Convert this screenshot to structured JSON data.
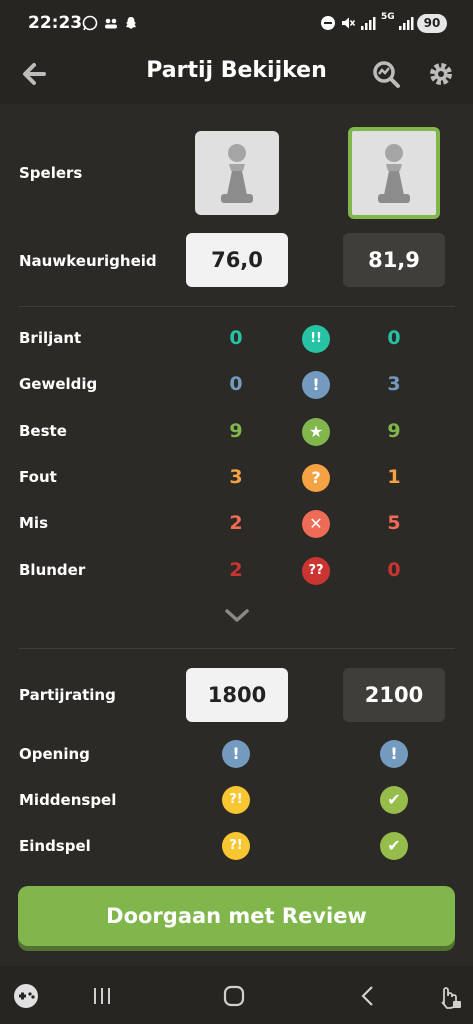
{
  "status": {
    "time": "22:23",
    "battery": "90",
    "network": "5G"
  },
  "header": {
    "title": "Partij Bekijken"
  },
  "rows": {
    "players": "Spelers",
    "accuracy": {
      "label": "Nauwkeurigheid",
      "white": "76,0",
      "black": "81,9"
    }
  },
  "moves": [
    {
      "label": "Briljant",
      "white": "0",
      "black": "0",
      "color": "#26c2a3",
      "icon": "double-exclamation-icon",
      "glyph": "!!"
    },
    {
      "label": "Geweldig",
      "white": "0",
      "black": "3",
      "color": "#749bbf",
      "icon": "exclamation-icon",
      "glyph": "!"
    },
    {
      "label": "Beste",
      "white": "9",
      "black": "9",
      "color": "#81b64c",
      "icon": "star-icon",
      "glyph": "★"
    },
    {
      "label": "Fout",
      "white": "3",
      "black": "1",
      "color": "#f7a145",
      "icon": "question-icon",
      "glyph": "?"
    },
    {
      "label": "Mis",
      "white": "2",
      "black": "5",
      "color": "#ee6b55",
      "icon": "cross-icon",
      "glyph": "✕"
    },
    {
      "label": "Blunder",
      "white": "2",
      "black": "0",
      "color": "#ca3431",
      "icon": "double-question-icon",
      "glyph": "??"
    }
  ],
  "rating": {
    "label": "Partijrating",
    "white": "1800",
    "black": "2100"
  },
  "phases": [
    {
      "label": "Opening",
      "white_icon": "great-move-icon",
      "white_glyph": "!",
      "white_color": "#749bbf",
      "black_icon": "great-move-icon",
      "black_glyph": "!",
      "black_color": "#749bbf"
    },
    {
      "label": "Middenspel",
      "white_icon": "inaccuracy-icon",
      "white_glyph": "?!",
      "white_color": "#f7c631",
      "black_icon": "check-icon",
      "black_glyph": "✔",
      "black_color": "#96bc4b"
    },
    {
      "label": "Eindspel",
      "white_icon": "inaccuracy-icon",
      "white_glyph": "?!",
      "white_color": "#f7c631",
      "black_icon": "check-icon",
      "black_glyph": "✔",
      "black_color": "#96bc4b"
    }
  ],
  "cta": {
    "label": "Doorgaan met Review"
  }
}
